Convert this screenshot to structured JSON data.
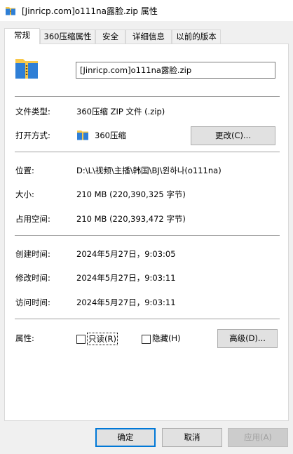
{
  "window": {
    "title": "[Jinricp.com]o111na露脸.zip 属性"
  },
  "tabs": [
    {
      "label": "常规",
      "active": true
    },
    {
      "label": "360压缩属性",
      "active": false
    },
    {
      "label": "安全",
      "active": false
    },
    {
      "label": "详细信息",
      "active": false
    },
    {
      "label": "以前的版本",
      "active": false
    }
  ],
  "general": {
    "file_name": "[Jinricp.com]o111na露脸.zip",
    "file_type_label": "文件类型:",
    "file_type_value": "360压缩 ZIP 文件 (.zip)",
    "open_with_label": "打开方式:",
    "open_with_value": "360压缩",
    "change_button": "更改(C)...",
    "location_label": "位置:",
    "location_value": "D:\\L\\视频\\主播\\韩国\\BJ\\윈하나(o111na)",
    "size_label": "大小:",
    "size_value": "210 MB (220,390,325 字节)",
    "size_on_disk_label": "占用空间:",
    "size_on_disk_value": "210 MB (220,393,472 字节)",
    "created_label": "创建时间:",
    "created_value": "2024年5月27日，9:03:05",
    "modified_label": "修改时间:",
    "modified_value": "2024年5月27日，9:03:11",
    "accessed_label": "访问时间:",
    "accessed_value": "2024年5月27日，9:03:11",
    "attributes_label": "属性:",
    "readonly_label": "只读(R)",
    "readonly_checked": false,
    "hidden_label": "隐藏(H)",
    "hidden_checked": false,
    "advanced_button": "高级(D)..."
  },
  "footer": {
    "ok_button": "确定",
    "cancel_button": "取消",
    "apply_button": "应用(A)",
    "apply_enabled": false
  },
  "colors": {
    "folder_yellow": "#f8c84a",
    "zip_blue": "#2f7fd6",
    "default_button_border": "#0078d7"
  },
  "icons": {
    "title": "zip-archive-icon",
    "file": "zip-archive-icon",
    "open_with": "360-compress-icon"
  }
}
